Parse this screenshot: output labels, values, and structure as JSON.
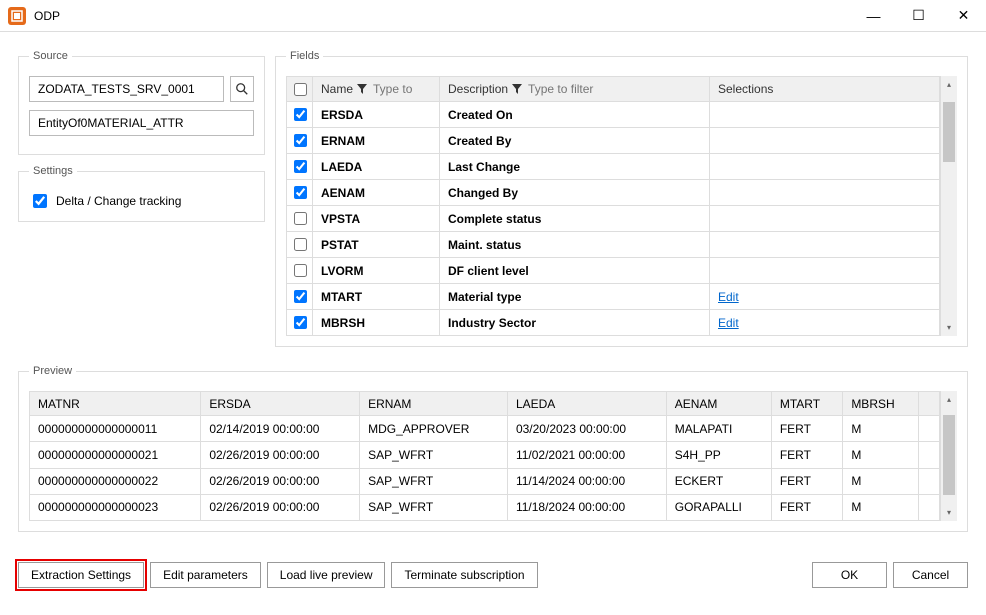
{
  "window": {
    "title": "ODP",
    "minimize_glyph": "—",
    "maximize_glyph": "☐",
    "close_glyph": "✕"
  },
  "source": {
    "legend": "Source",
    "service_value": "ZODATA_TESTS_SRV_0001",
    "entity_value": "EntityOf0MATERIAL_ATTR",
    "search_icon_glyph": "search"
  },
  "settings": {
    "legend": "Settings",
    "delta_label": "Delta / Change tracking",
    "delta_checked": true
  },
  "fields": {
    "legend": "Fields",
    "headers": {
      "name": "Name",
      "name_placeholder": "Type to",
      "description": "Description",
      "description_placeholder": "Type to filter",
      "selections": "Selections"
    },
    "rows": [
      {
        "checked": true,
        "name": "ERSDA",
        "desc": "Created On",
        "sel": ""
      },
      {
        "checked": true,
        "name": "ERNAM",
        "desc": "Created By",
        "sel": ""
      },
      {
        "checked": true,
        "name": "LAEDA",
        "desc": "Last Change",
        "sel": ""
      },
      {
        "checked": true,
        "name": "AENAM",
        "desc": "Changed By",
        "sel": ""
      },
      {
        "checked": false,
        "name": "VPSTA",
        "desc": "Complete status",
        "sel": ""
      },
      {
        "checked": false,
        "name": "PSTAT",
        "desc": "Maint. status",
        "sel": ""
      },
      {
        "checked": false,
        "name": "LVORM",
        "desc": "DF client level",
        "sel": ""
      },
      {
        "checked": true,
        "name": "MTART",
        "desc": "Material type",
        "sel": "Edit"
      },
      {
        "checked": true,
        "name": "MBRSH",
        "desc": "Industry Sector",
        "sel": "Edit"
      }
    ]
  },
  "preview": {
    "legend": "Preview",
    "columns": [
      "MATNR",
      "ERSDA",
      "ERNAM",
      "LAEDA",
      "AENAM",
      "MTART",
      "MBRSH"
    ],
    "rows": [
      [
        "000000000000000011",
        "02/14/2019 00:00:00",
        "MDG_APPROVER",
        "03/20/2023 00:00:00",
        "MALAPATI",
        "FERT",
        "M"
      ],
      [
        "000000000000000021",
        "02/26/2019 00:00:00",
        "SAP_WFRT",
        "11/02/2021 00:00:00",
        "S4H_PP",
        "FERT",
        "M"
      ],
      [
        "000000000000000022",
        "02/26/2019 00:00:00",
        "SAP_WFRT",
        "11/14/2024 00:00:00",
        "ECKERT",
        "FERT",
        "M"
      ],
      [
        "000000000000000023",
        "02/26/2019 00:00:00",
        "SAP_WFRT",
        "11/18/2024 00:00:00",
        "GORAPALLI",
        "FERT",
        "M"
      ]
    ]
  },
  "buttons": {
    "extraction_settings": "Extraction Settings",
    "edit_parameters": "Edit parameters",
    "load_preview": "Load live preview",
    "terminate": "Terminate subscription",
    "ok": "OK",
    "cancel": "Cancel"
  }
}
